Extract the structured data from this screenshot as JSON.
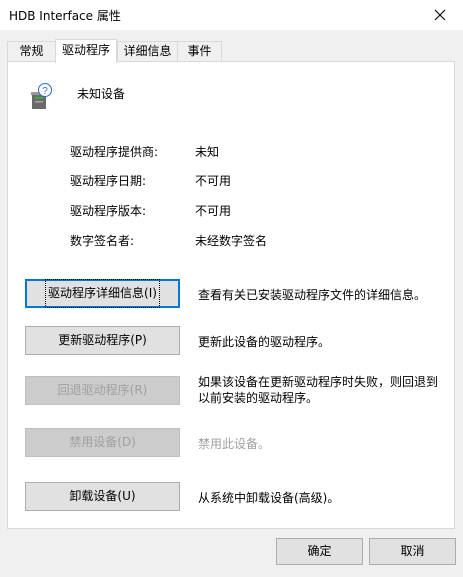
{
  "window": {
    "title": "HDB Interface 属性"
  },
  "tabs": [
    {
      "label": "常规"
    },
    {
      "label": "驱动程序"
    },
    {
      "label": "详细信息"
    },
    {
      "label": "事件"
    }
  ],
  "device": {
    "name": "未知设备",
    "icon": "unknown-device-icon"
  },
  "properties": {
    "provider_label": "驱动程序提供商:",
    "provider_value": "未知",
    "date_label": "驱动程序日期:",
    "date_value": "不可用",
    "version_label": "驱动程序版本:",
    "version_value": "不可用",
    "signer_label": "数字签名者:",
    "signer_value": "未经数字签名"
  },
  "actions": {
    "details_button": "驱动程序详细信息(I)",
    "details_desc": "查看有关已安装驱动程序文件的详细信息。",
    "update_button": "更新驱动程序(P)",
    "update_desc": "更新此设备的驱动程序。",
    "rollback_button": "回退驱动程序(R)",
    "rollback_desc": "如果该设备在更新驱动程序时失败，则回退到以前安装的驱动程序。",
    "disable_button": "禁用设备(D)",
    "disable_desc": "禁用此设备。",
    "uninstall_button": "卸载设备(U)",
    "uninstall_desc": "从系统中卸载设备(高级)。"
  },
  "footer": {
    "ok_label": "确定",
    "cancel_label": "取消"
  }
}
